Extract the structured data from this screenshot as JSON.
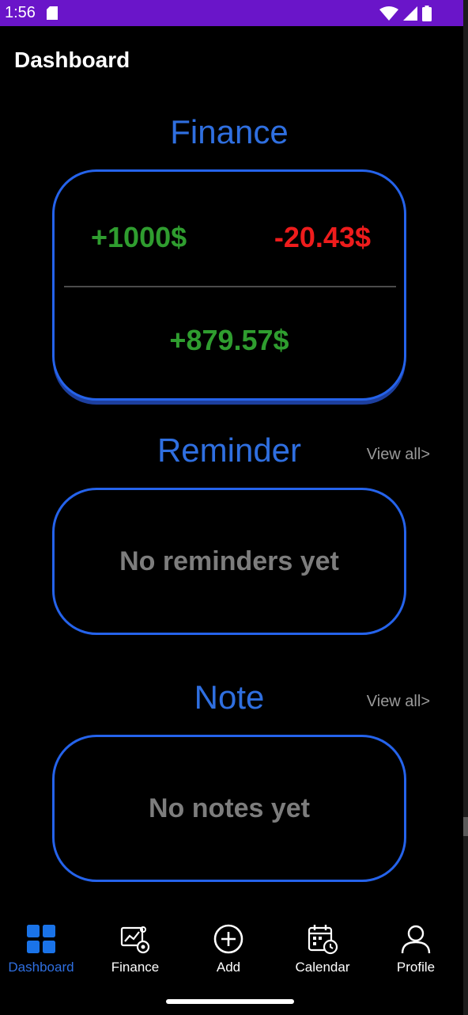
{
  "status_bar": {
    "time": "1:56",
    "icons": [
      "sd-card-icon",
      "wifi-icon",
      "signal-icon",
      "battery-icon"
    ]
  },
  "app_bar": {
    "title": "Dashboard"
  },
  "finance": {
    "title": "Finance",
    "income": "+1000$",
    "expense": "-20.43$",
    "balance": "+879.57$"
  },
  "reminder": {
    "title": "Reminder",
    "view_all": "View all>",
    "empty_text": "No reminders yet"
  },
  "note": {
    "title": "Note",
    "view_all": "View all>",
    "empty_text": "No notes yet"
  },
  "bottom_nav": {
    "items": [
      {
        "label": "Dashboard",
        "icon": "dashboard-grid-icon",
        "active": true
      },
      {
        "label": "Finance",
        "icon": "finance-chart-icon",
        "active": false
      },
      {
        "label": "Add",
        "icon": "add-circle-icon",
        "active": false
      },
      {
        "label": "Calendar",
        "icon": "calendar-clock-icon",
        "active": false
      },
      {
        "label": "Profile",
        "icon": "person-icon",
        "active": false
      }
    ]
  },
  "colors": {
    "status_bar": "#6a15c9",
    "accent": "#2f6fe0",
    "card_border": "#2563eb",
    "positive": "#2f9d2f",
    "negative": "#ee1c1c",
    "muted_text": "#7d7d7d",
    "background": "#000000"
  }
}
